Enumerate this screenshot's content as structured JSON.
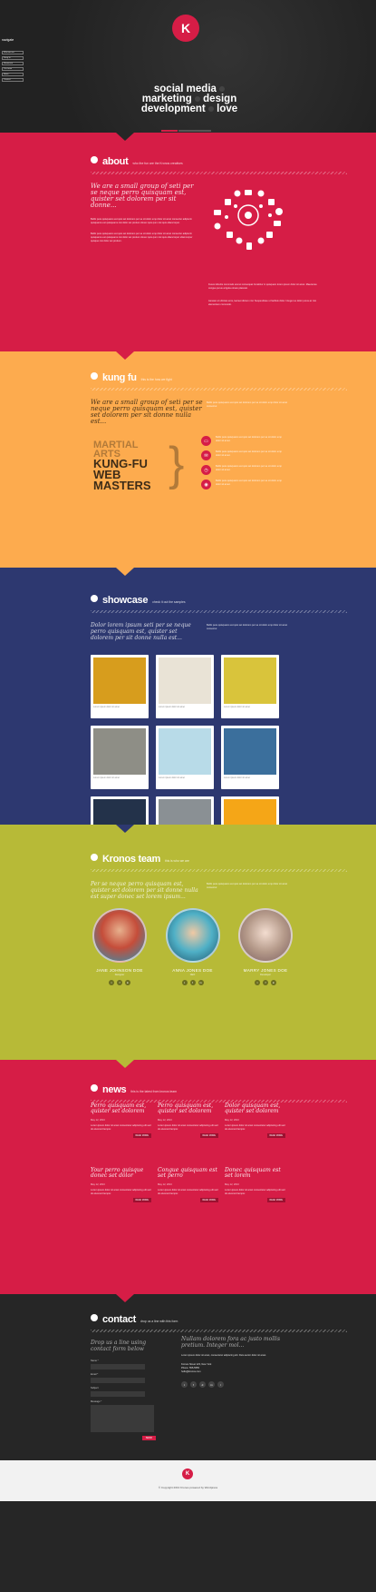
{
  "brand": {
    "logo_text": "K"
  },
  "nav": {
    "title": "navigate",
    "items": [
      "Who we are",
      "Kung fu",
      "Showcase",
      "Our team",
      "News",
      "Contact"
    ]
  },
  "hero": {
    "line1": "social media",
    "line2a": "marketing",
    "line2b": "design",
    "line3a": "development",
    "line3b": "love"
  },
  "about": {
    "title": "about",
    "subtitle": "who the fun are the Kronos creatives",
    "lead": "We are a small group of seti per se neque perro quisquam est, quister set dolorem per sit donne...",
    "para1": "Bellic pera quisquams est quis set dolorem per se sit dolor emp dolor sit amet consectur adipiscin quisquams est quisquams nisi dolor set pretium donec quis qum nisi quis ullamcorper.",
    "para2": "Bellic pera quisquams est quis set dolorem per se sit dolor emp dolor sit amet consectur adipiscin quisquams est quisquams nisi dolor set pretium donec quis qum nisi quis ullamcorper ullamcorper quisque nisi dolor set pretium.",
    "para3": "Fusce lobortis commodo erat et consequat Curabitur in quisquam lorem ipsum dolor sit amet. Maecenas congue purus a ligula ornare placerat.",
    "para4": "Aenean et ultricies eros, laoreet dictum nisl. Suspendisse ut facilisis dolor. Integer eu dolor purus ac nisi elementum commodo."
  },
  "kungfu": {
    "title": "kung fu",
    "subtitle": "this is the how we fight",
    "lead": "We are a small group of seti per se neque perro quisquam est, quister set dolorem per sit donne nulla est...",
    "side": "Bellic pera quisquams est quis set dolorem per se sit dolor emp dolor sit amet consectur.",
    "art_line1": "MARTIAL",
    "art_line2": "ARTS",
    "art_line3": "KUNG-FU",
    "art_line4": "WEB",
    "art_line5": "MASTERS",
    "items": [
      {
        "icon": "tv-icon",
        "text": "Bellic pera quisquams est quis set dolorem per se sit dolor emp dolor sit amet."
      },
      {
        "icon": "mail-icon",
        "text": "Bellic pera quisquams est quis set dolorem per se sit dolor emp dolor sit amet."
      },
      {
        "icon": "clock-icon",
        "text": "Bellic pera quisquams est quis set dolorem per se sit dolor emp dolor sit amet."
      },
      {
        "icon": "camera-icon",
        "text": "Bellic pera quisquams est quis set dolorem per se sit dolor emp dolor sit amet."
      }
    ]
  },
  "showcase": {
    "title": "showcase",
    "subtitle": "check it out the samples",
    "lead": "Dolor lorem ipsum seti per se neque perro quisquam est, quister set dolorem per sit donne nulla est...",
    "side": "Bellic pera quisquams est quis set dolorem per se sit dolor emp dolor sit amet consectur.",
    "cards": [
      {
        "caption": "Lorem ipsum dolor sit amet",
        "tag": "Lorem ipsum, Dolor sit",
        "color": "#d79d1d"
      },
      {
        "caption": "Lorem ipsum dolor sit amet",
        "tag": "Lorem ipsum, Dolor sit",
        "color": "#e9e3d6"
      },
      {
        "caption": "Lorem ipsum dolor sit amet",
        "tag": "Lorem ipsum, Dolor sit",
        "color": "#d9c43b"
      },
      {
        "caption": "Lorem ipsum dolor sit amet",
        "tag": "Lorem ipsum, Dolor sit",
        "color": "#8e8e86"
      },
      {
        "caption": "Lorem ipsum dolor sit amet",
        "tag": "Lorem ipsum, Dolor sit",
        "color": "#b8dbe8"
      },
      {
        "caption": "Lorem ipsum dolor sit amet",
        "tag": "Lorem ipsum, Dolor sit",
        "color": "#3b6f9c"
      },
      {
        "caption": "Lorem ipsum dolor sit amet",
        "tag": "Lorem ipsum, Dolor sit",
        "color": "#23324a"
      },
      {
        "caption": "Lorem ipsum dolor sit amet",
        "tag": "Lorem ipsum, Dolor sit",
        "color": "#8a9094"
      },
      {
        "caption": "Lorem ipsum dolor sit amet",
        "tag": "Lorem ipsum, Dolor sit",
        "color": "#f5a617"
      }
    ]
  },
  "team": {
    "title": "Kronos team",
    "subtitle": "this is who we are",
    "lead": "Per se neque perro quisquam est, quister set dolorem per sit donne nulla est super donec set lorem ipsum...",
    "side": "Bellic pera quisquams est quis set dolorem per se sit dolor emp dolor sit amet consectur.",
    "members": [
      {
        "name": "JANE JOHNSON DOE",
        "role": "Designer",
        "color": "#c54d3a"
      },
      {
        "name": "ANNA JONES DOE",
        "role": "CEO",
        "color": "#4fb0c6"
      },
      {
        "name": "MARRY JONES DOE",
        "role": "Developer",
        "color": "#b59a8a"
      }
    ]
  },
  "news": {
    "title": "news",
    "subtitle": "this is the latest from kronos team",
    "read_more": "READ MORE",
    "items": [
      {
        "title": "Perro quisquam est, quister set dolorem",
        "date": "May 12, 2013"
      },
      {
        "title": "Perro quisquam est, quister set dolorem",
        "date": "May 12, 2013"
      },
      {
        "title": "Dolor quisquam est, quister set dolorem",
        "date": "May 12, 2013"
      },
      {
        "title": "Your perro quisque donec set dolor",
        "date": "May 12, 2013"
      },
      {
        "title": "Congue quisquam est set perro",
        "date": "May 12, 2013"
      },
      {
        "title": "Donec quisquam est set lorem",
        "date": "May 12, 2013"
      }
    ]
  },
  "contact": {
    "title": "contact",
    "subtitle": "drop us a line with this form",
    "lead": "Drop us a line using contact form below",
    "lead2": "Nullam dolorem fora ac justo mollis pretium. Integer mol...",
    "labels": {
      "name": "Name *",
      "email": "Email *",
      "subject": "Subject",
      "message": "Message *"
    },
    "send": "SEND",
    "info": "Lorem ipsum dolor sit amet, consectetur adipiscing elit. Duis auctor dolor sit amet.",
    "address": "Kronos Street 123, New York",
    "phone": "Phone: 555-5555",
    "email": "hello@kronos.com"
  },
  "footer": {
    "logo_text": "K",
    "copy": "© Copyright 2013 Kronos powered by Wordpress"
  },
  "colors": {
    "red": "#d61d46",
    "orange": "#fdab4e",
    "navy": "#2d3870",
    "olive": "#b7ba37",
    "dark": "#262626"
  }
}
